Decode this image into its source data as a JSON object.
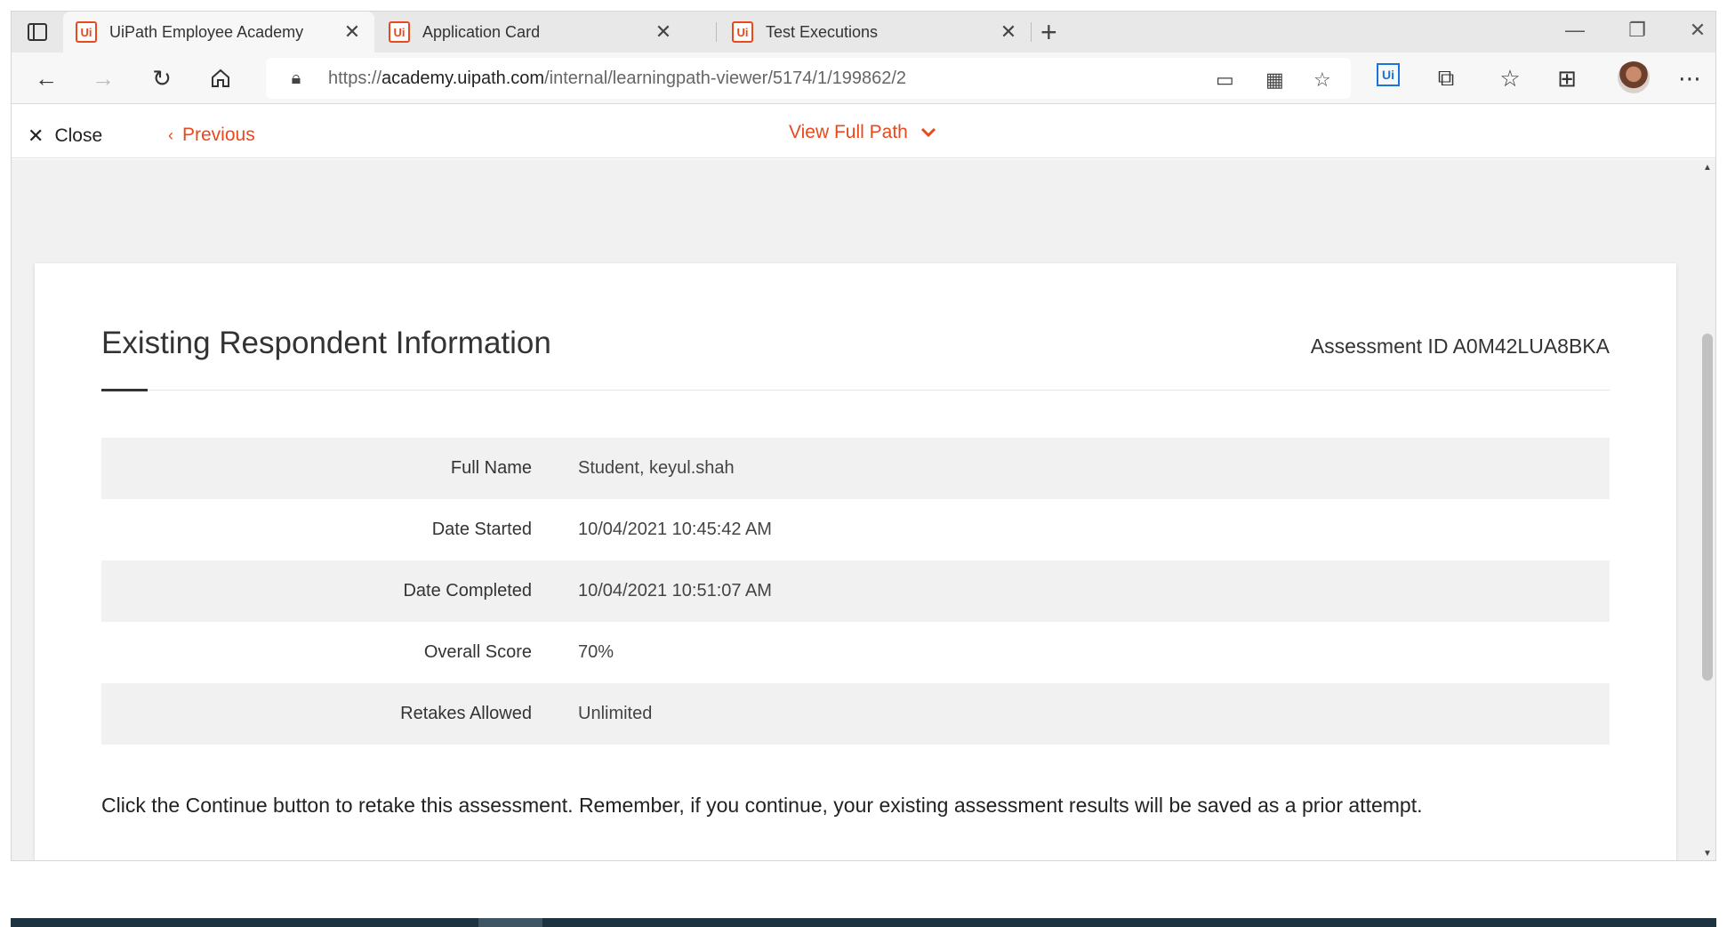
{
  "browser": {
    "tabs": [
      {
        "favicon": "Ui",
        "title": "UiPath Employee Academy",
        "active": true
      },
      {
        "favicon": "Ui",
        "title": "Application Card",
        "active": false
      },
      {
        "favicon": "Ui",
        "title": "Test Executions",
        "active": false
      }
    ],
    "url_prefix": "https://",
    "url_host": "academy.uipath.com",
    "url_path": "/internal/learningpath-viewer/5174/1/199862/2",
    "extension_label": "Ui",
    "icons": {
      "back": "back-arrow-icon",
      "forward": "forward-arrow-icon",
      "refresh": "refresh-icon",
      "home": "home-icon",
      "lock": "lock-icon",
      "more": "more-icon"
    }
  },
  "nav": {
    "close_label": "Close",
    "previous_label": "Previous",
    "full_path_label": "View Full Path"
  },
  "card": {
    "title": "Existing Respondent Information",
    "assessment_id_label": "Assessment ID",
    "assessment_id": "A0M42LUA8BKA",
    "rows": [
      {
        "label": "Full Name",
        "value": "Student, keyul.shah"
      },
      {
        "label": "Date Started",
        "value": "10/04/2021 10:45:42 AM"
      },
      {
        "label": "Date Completed",
        "value": "10/04/2021 10:51:07 AM"
      },
      {
        "label": "Overall Score",
        "value": "70%"
      },
      {
        "label": "Retakes Allowed",
        "value": "Unlimited"
      }
    ],
    "note": "Click the Continue button to retake this assessment. Remember, if you continue, your existing assessment results will be saved as a prior attempt."
  },
  "colors": {
    "accent": "#e8491d",
    "row_bg": "#f1f1f1",
    "page_bg": "#f1f1f1"
  }
}
